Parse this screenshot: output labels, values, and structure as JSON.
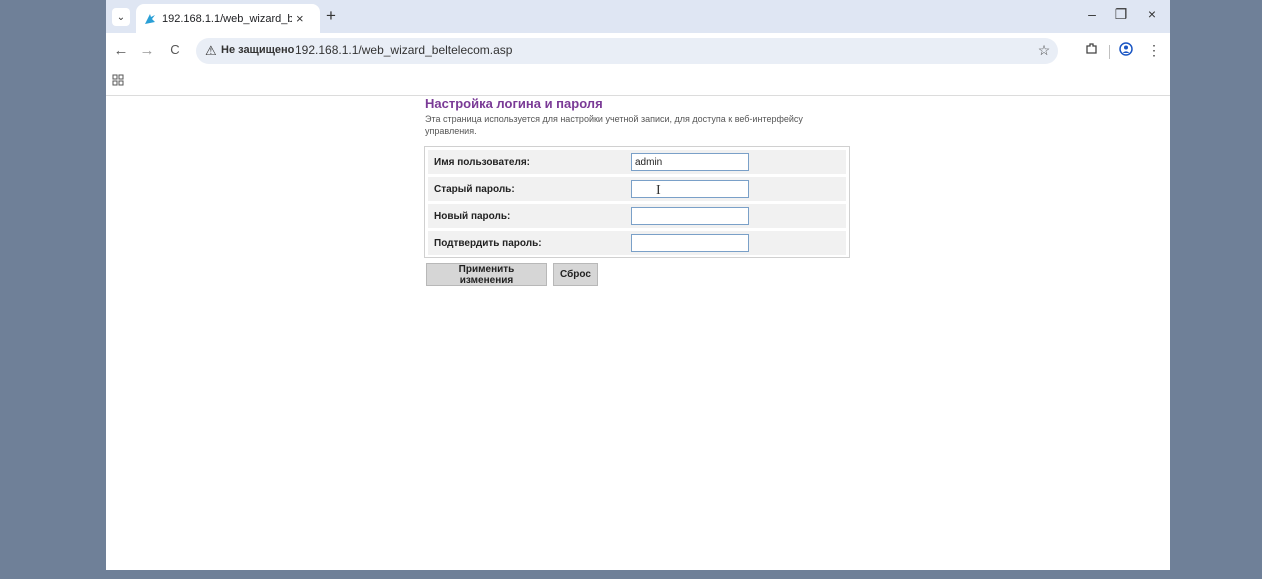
{
  "tab": {
    "title": "192.168.1.1/web_wizard_beltele",
    "close": "×"
  },
  "new_tab": "+",
  "window": {
    "minimize": "–",
    "restore": "❐",
    "close": "×"
  },
  "nav": {
    "back": "←",
    "forward": "→",
    "reload": "C"
  },
  "omnibox": {
    "security_label": "Не защищено",
    "url": "192.168.1.1/web_wizard_beltelecom.asp"
  },
  "page": {
    "title": "Настройка логина и пароля",
    "description": "Эта страница используется для настройки учетной записи, для доступа к веб-интерфейсу управления."
  },
  "form": {
    "rows": [
      {
        "label": "Имя пользователя:",
        "value": "admin"
      },
      {
        "label": "Старый пароль:",
        "value": ""
      },
      {
        "label": "Новый пароль:",
        "value": ""
      },
      {
        "label": "Подтвердить пароль:",
        "value": ""
      }
    ]
  },
  "buttons": {
    "apply": "Применить изменения",
    "reset": "Сброс"
  },
  "icons": {
    "tab_dropdown": "chevron-down-icon",
    "favicon": "site-favicon-icon",
    "warning": "warning-triangle-icon",
    "bookmark": "star-icon",
    "extensions": "puzzle-icon",
    "profile": "profile-icon",
    "menu": "kebab-menu-icon",
    "apps": "apps-grid-icon"
  },
  "colors": {
    "page_title": "#7a3a96",
    "tabbar": "#dfe6f3",
    "outer_bg": "#6f8098"
  }
}
